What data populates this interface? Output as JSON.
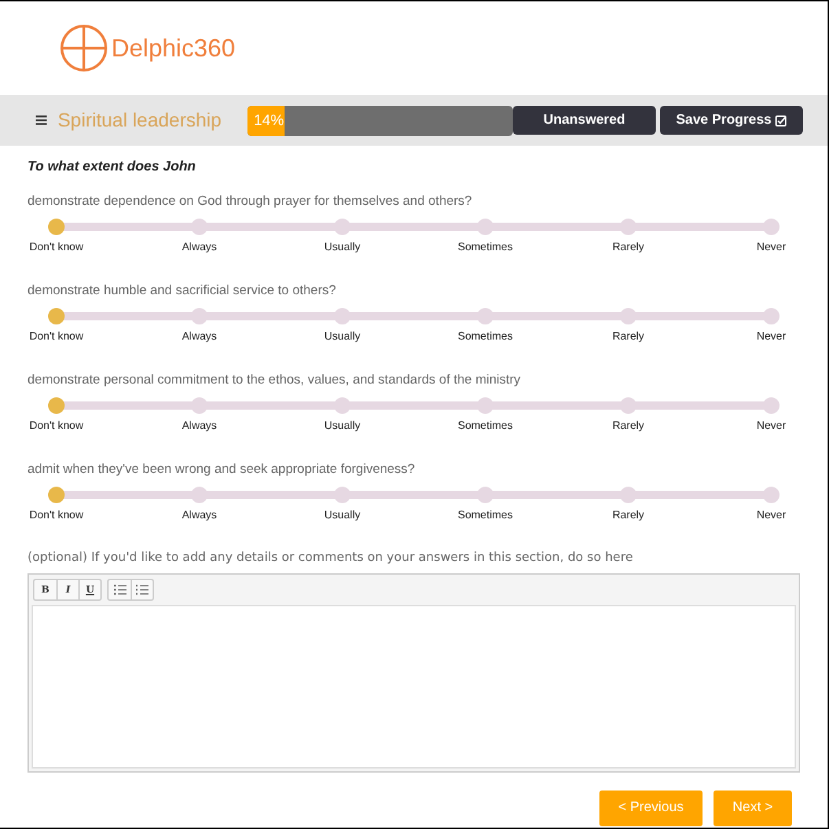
{
  "logo": {
    "text": "Delphic360"
  },
  "toolbar": {
    "section_title": "Spiritual leadership",
    "progress": {
      "level": 0.14,
      "reading": "14%"
    },
    "buttons": [
      "Unanswered",
      "Save Progress"
    ]
  },
  "prompt": "To what extent does John",
  "questions": [
    {
      "text": "demonstrate dependence on God through prayer for themselves and others?",
      "options": [
        {
          "label": "Don't know",
          "selected": true
        },
        {
          "label": "Always",
          "selected": false
        },
        {
          "label": "Usually",
          "selected": false
        },
        {
          "label": "Sometimes",
          "selected": false
        },
        {
          "label": "Rarely",
          "selected": false
        },
        {
          "label": "Never",
          "selected": false
        }
      ]
    },
    {
      "text": "demonstrate humble and sacrificial service to others?",
      "options": [
        {
          "label": "Don't know",
          "selected": true
        },
        {
          "label": "Always",
          "selected": false
        },
        {
          "label": "Usually",
          "selected": false
        },
        {
          "label": "Sometimes",
          "selected": false
        },
        {
          "label": "Rarely",
          "selected": false
        },
        {
          "label": "Never",
          "selected": false
        }
      ]
    },
    {
      "text": "demonstrate personal commitment to the ethos, values, and standards of the ministry",
      "options": [
        {
          "label": "Don't know",
          "selected": true
        },
        {
          "label": "Always",
          "selected": false
        },
        {
          "label": "Usually",
          "selected": false
        },
        {
          "label": "Sometimes",
          "selected": false
        },
        {
          "label": "Rarely",
          "selected": false
        },
        {
          "label": "Never",
          "selected": false
        }
      ]
    },
    {
      "text": "admit when they've been wrong and seek appropriate forgiveness?",
      "options": [
        {
          "label": "Don't know",
          "selected": true
        },
        {
          "label": "Always",
          "selected": false
        },
        {
          "label": "Usually",
          "selected": false
        },
        {
          "label": "Sometimes",
          "selected": false
        },
        {
          "label": "Rarely",
          "selected": false
        },
        {
          "label": "Never",
          "selected": false
        }
      ]
    }
  ],
  "comments": {
    "label": "(optional) If you'd like to add any details or comments on your answers in this section, do so here",
    "format_buttons": [
      "B",
      "I",
      "U"
    ]
  },
  "navigation": [
    "< Previous",
    "Next >"
  ]
}
